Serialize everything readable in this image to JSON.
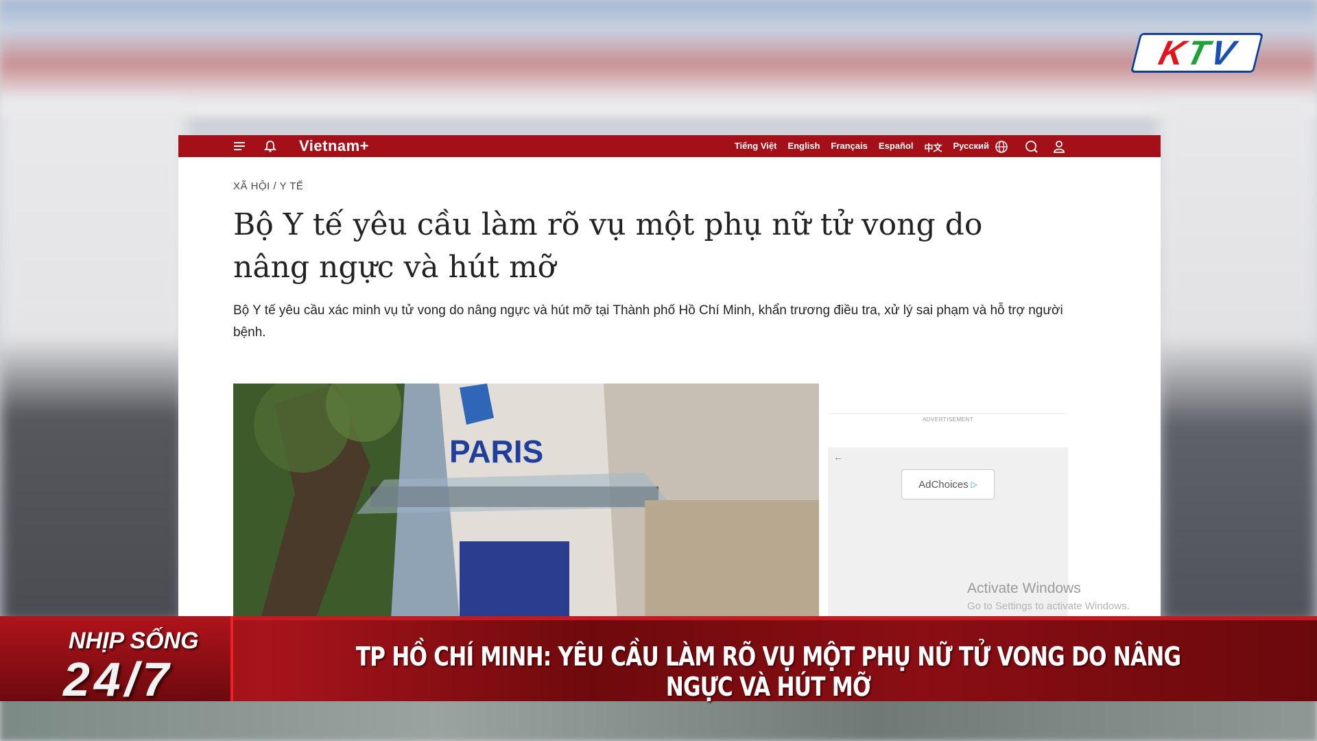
{
  "channel_logo": {
    "letters": [
      "K",
      "T",
      "V"
    ],
    "colors": [
      "#e3151c",
      "#1fa13a",
      "#1a4fb3"
    ]
  },
  "website": {
    "logo_text": "Vietnam+",
    "nav_color": "#a50f18",
    "languages": [
      "Tiếng Việt",
      "English",
      "Français",
      "Español",
      "中文",
      "Pусский"
    ],
    "icons": [
      "menu-icon",
      "bell-icon",
      "globe-icon",
      "search-icon",
      "user-icon"
    ],
    "breadcrumb": "XÃ HỘI / Y TẾ",
    "headline": "Bộ Y tế yêu cầu làm rõ vụ một phụ nữ tử vong do nâng ngực và hút mỡ",
    "sapo": "Bộ Y tế yêu cầu xác minh vụ tử vong do nâng ngực và hút mỡ tại Thành phố Hồ Chí Minh, khẩn trương điều tra, xử lý sai phạm và hỗ trợ người bệnh.",
    "photo_sign_text": "PARIS",
    "advertisement_label": "ADVERTISEMENT",
    "adchoices_label": "AdChoices"
  },
  "windows_watermark": {
    "title": "Activate Windows",
    "subtitle": "Go to Settings to activate Windows."
  },
  "lower_third": {
    "show_name": "NHỊP SỐNG",
    "show_time": "24/7",
    "headline": "TP HỒ CHÍ MINH: YÊU CẦU LÀM RÕ VỤ MỘT PHỤ NỮ TỬ VONG DO NÂNG NGỰC VÀ HÚT MỠ"
  }
}
